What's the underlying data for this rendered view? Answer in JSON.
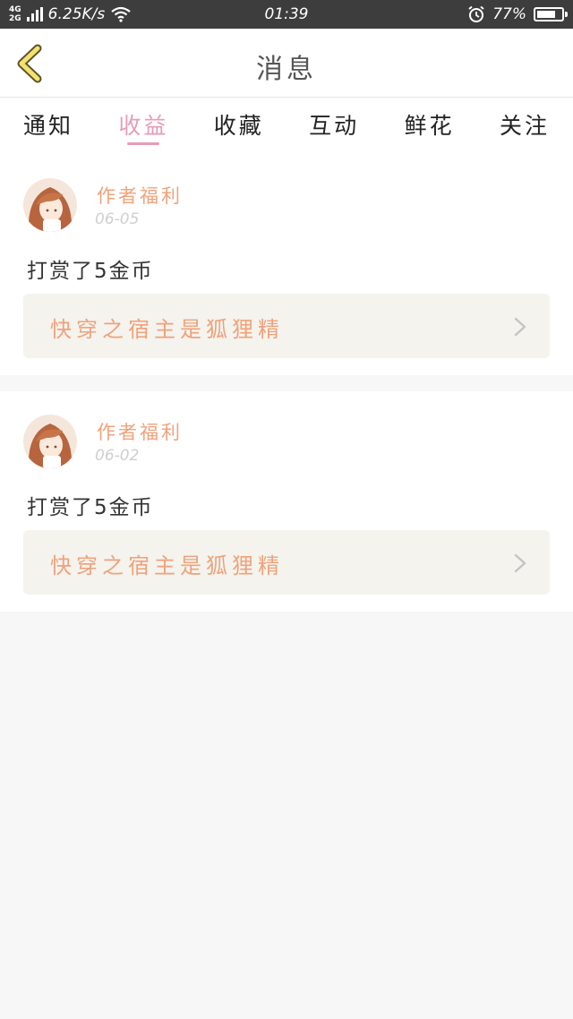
{
  "status_bar": {
    "network_top": "4G",
    "network_bottom": "2G",
    "speed": "6.25K/s",
    "time": "01:39",
    "battery": "77%",
    "battery_level": 0.77
  },
  "header": {
    "title": "消息",
    "back_icon": "chevron-left-icon"
  },
  "tabs": [
    {
      "label": "通知",
      "active": false
    },
    {
      "label": "收益",
      "active": true
    },
    {
      "label": "收藏",
      "active": false
    },
    {
      "label": "互动",
      "active": false
    },
    {
      "label": "鲜花",
      "active": false
    },
    {
      "label": "关注",
      "active": false
    }
  ],
  "messages": [
    {
      "sender": "作者福利",
      "date": "06-05",
      "text": "打赏了5金币",
      "book": "快穿之宿主是狐狸精"
    },
    {
      "sender": "作者福利",
      "date": "06-02",
      "text": "打赏了5金币",
      "book": "快穿之宿主是狐狸精"
    }
  ],
  "colors": {
    "accent_pink": "#e79cb5",
    "accent_orange": "#f0a27a",
    "back_chevron": "#f3e36a"
  }
}
